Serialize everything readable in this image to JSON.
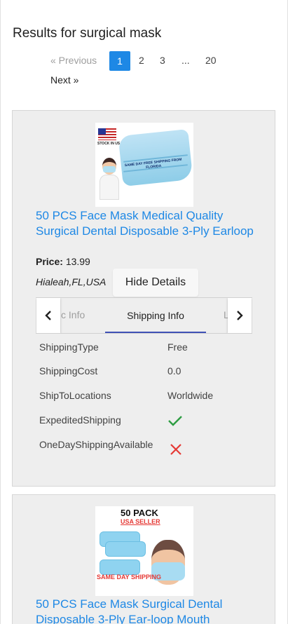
{
  "header": {
    "title": "Results for surgical mask"
  },
  "pagination": {
    "prev_label": "«   Previous",
    "active_page": "1",
    "pages": [
      "2",
      "3",
      "...",
      "20"
    ],
    "next_label": "Next   »",
    "colors": {
      "active_bg": "#1e88e5",
      "disabled": "#9e9e9e"
    }
  },
  "products": [
    {
      "image": {
        "stock_text": "STOCK IN USA",
        "caption": "SAME DAY FREE SHIPPING FROM FLORIDA"
      },
      "title": "50 PCS Face Mask Medical Quality Surgical Dental Disposable 3-Ply Earloop",
      "price_label": "Price:",
      "price_value": "13.99",
      "location": "Hialeah,FL,USA",
      "hide_details_label": "Hide Details",
      "tabs": {
        "left_partial": "c Info",
        "active": "Shipping Info",
        "right_partial": "L",
        "left_arrow_icon": "chevron-left-icon",
        "right_arrow_icon": "chevron-right-icon"
      },
      "shipping_info": [
        {
          "key": "ShippingType",
          "value": "Free"
        },
        {
          "key": "ShippingCost",
          "value": "0.0"
        },
        {
          "key": "ShipToLocations",
          "value": "Worldwide"
        },
        {
          "key": "ExpeditedShipping",
          "value_icon": "check-icon"
        },
        {
          "key": "OneDayShippingAvailable",
          "value_icon": "cross-icon"
        }
      ]
    },
    {
      "image": {
        "pack_text": "50 PACK",
        "seller_text": "USA SELLER",
        "same_day_text": "SAME DAY SHIPPING"
      },
      "title": "50 PCS Face Mask Surgical Dental Disposable 3-Ply Ear-loop Mouth"
    }
  ],
  "colors": {
    "link": "#1e88e5",
    "card_bg": "#eeeeee",
    "tab_indicator": "#3f51b5",
    "check": "#2e9d43",
    "cross": "#e53935"
  }
}
